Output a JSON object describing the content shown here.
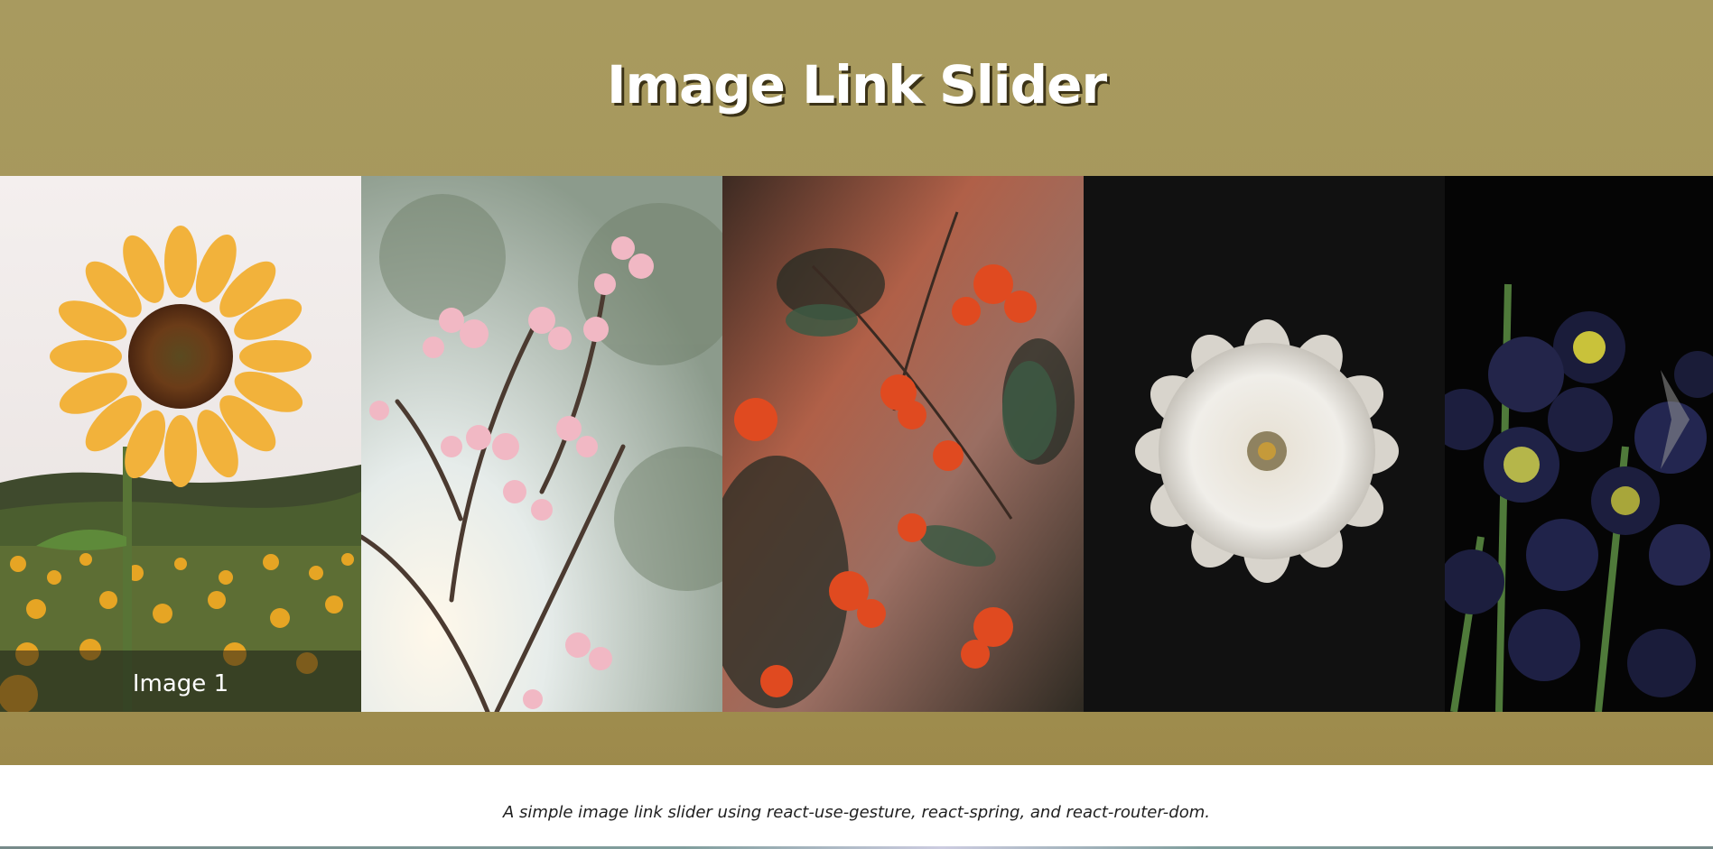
{
  "page": {
    "title": "Image Link Slider",
    "subtitle": "A simple image link slider using react-use-gesture, react-spring, and react-router-dom."
  },
  "slider": {
    "slides": [
      {
        "subject": "sunflower",
        "caption": "Image 1",
        "caption_visible": true
      },
      {
        "subject": "cherry-blossom",
        "caption": "",
        "caption_visible": false
      },
      {
        "subject": "red-berries",
        "caption": "",
        "caption_visible": false
      },
      {
        "subject": "white-zinnia",
        "caption": "",
        "caption_visible": false
      },
      {
        "subject": "dark-berries",
        "caption": "",
        "caption_visible": false
      }
    ],
    "next_icon": "chevron-right-icon"
  },
  "colors": {
    "hero_background": "#a59659",
    "title_text": "#ffffff",
    "title_shadow": "#3b3216",
    "caption_overlay": "rgba(20,20,20,0.5)"
  }
}
